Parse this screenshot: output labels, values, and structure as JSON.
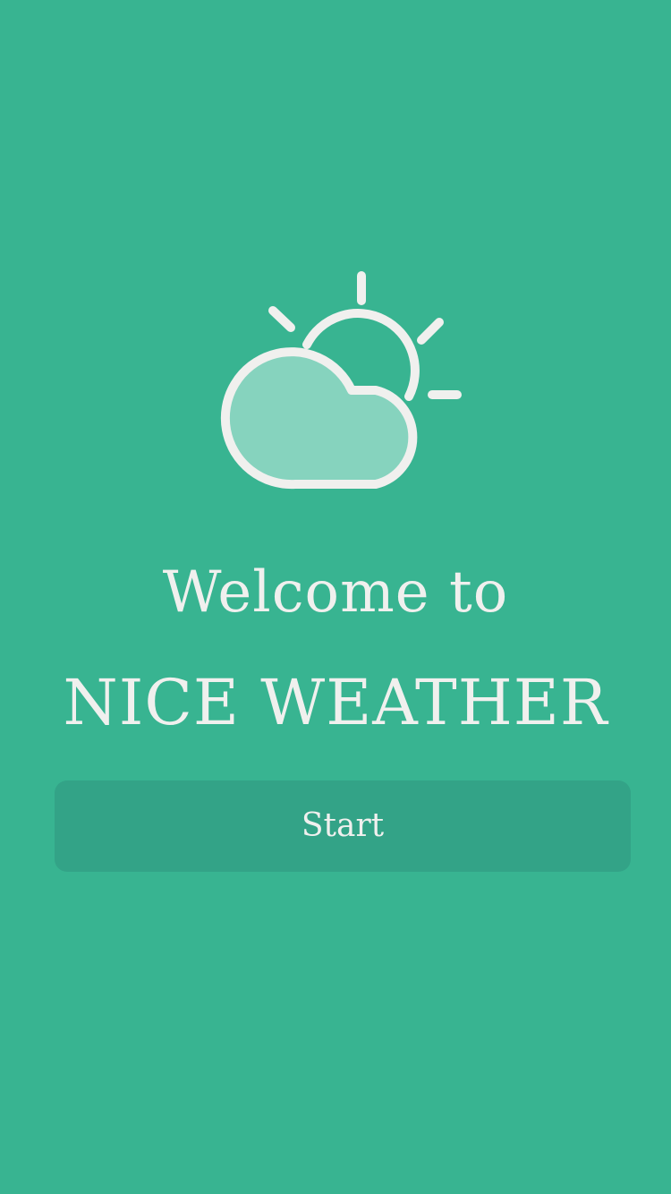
{
  "colors": {
    "background": "#38b491",
    "button_background": "#33a387",
    "foreground": "#f0f0ee",
    "cloud_fill": "#86d3be"
  },
  "logo": {
    "icon": "partly-cloudy-icon"
  },
  "welcome": {
    "line1": "Welcome to",
    "app_name": "NICE WEATHER"
  },
  "start_button": {
    "label": "Start"
  }
}
